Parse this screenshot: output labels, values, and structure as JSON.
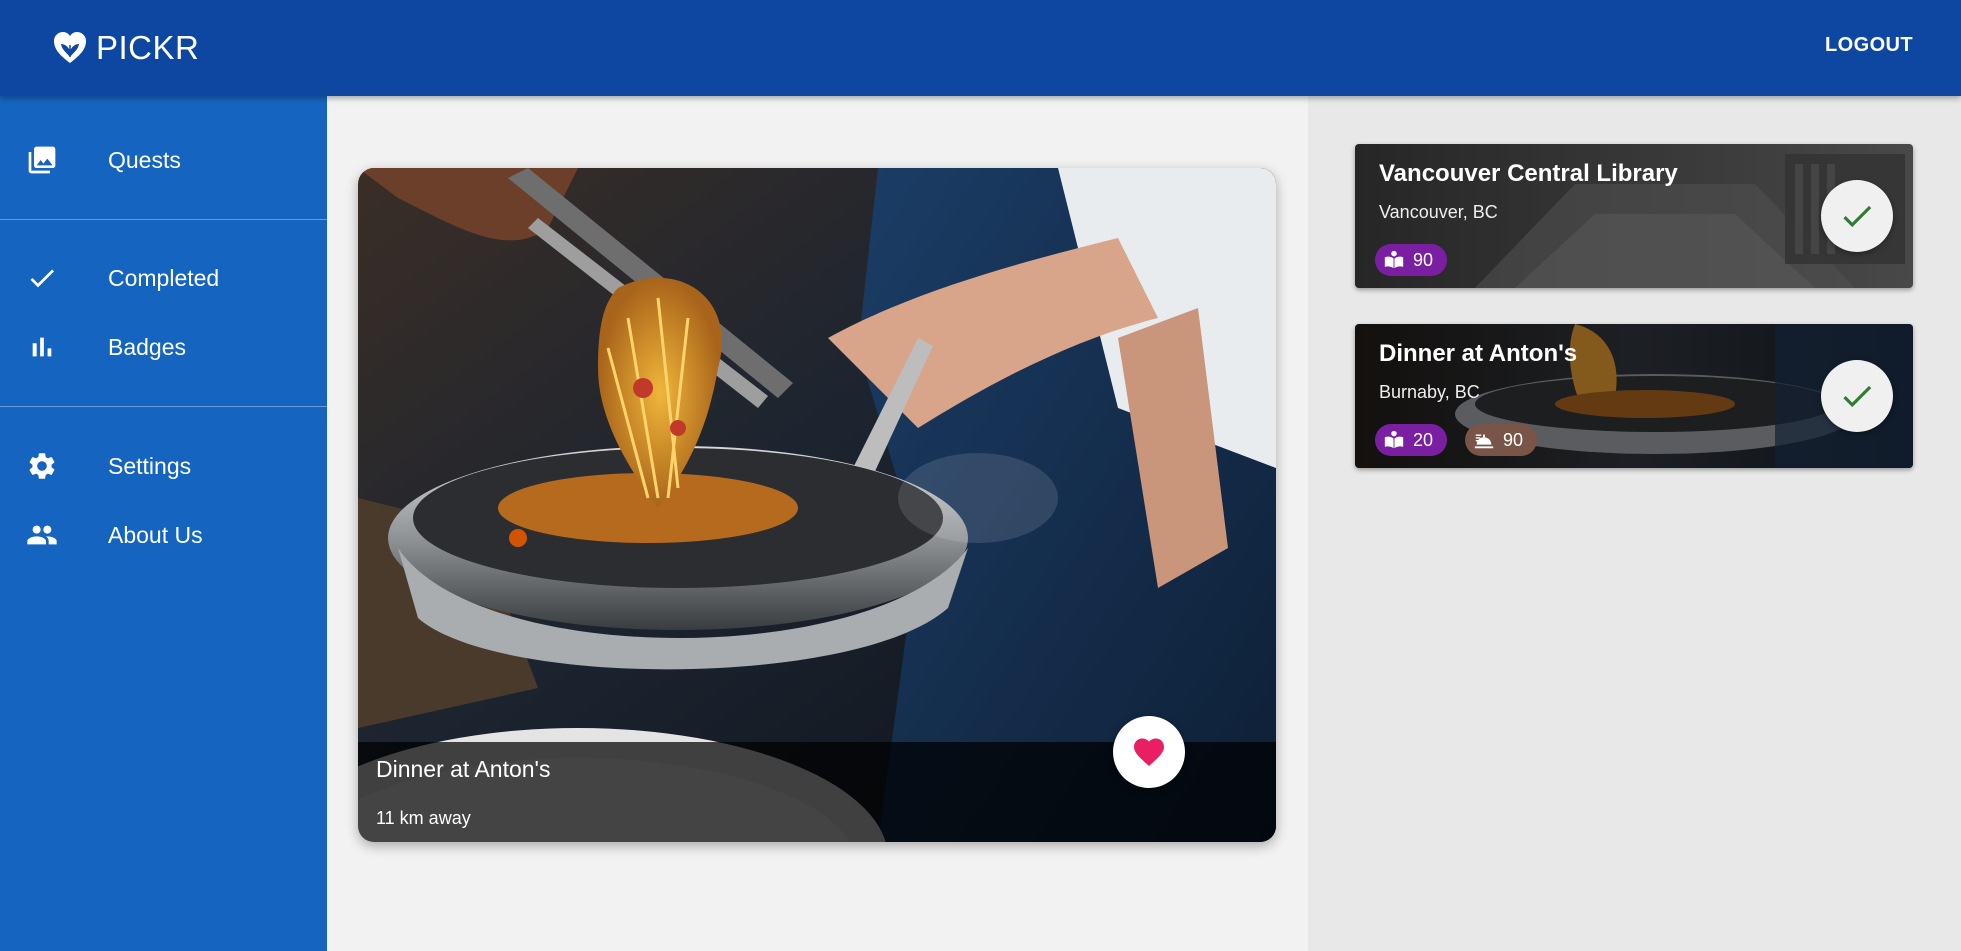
{
  "appbar": {
    "brand": "PICKR",
    "brand_icon": "heart-leaf-icon",
    "logout_label": "LOGOUT",
    "color": "#0d47a1"
  },
  "sidebar": {
    "color": "#1565c0",
    "items": [
      {
        "label": "Quests",
        "icon": "photo-library-icon"
      },
      {
        "label": "Completed",
        "icon": "check-icon"
      },
      {
        "label": "Badges",
        "icon": "bar-chart-icon"
      },
      {
        "label": "Settings",
        "icon": "gear-icon"
      },
      {
        "label": "About Us",
        "icon": "people-icon"
      }
    ]
  },
  "main": {
    "quest": {
      "title": "Dinner at Anton's",
      "distance": "11 km away",
      "favorite_icon": "heart-icon",
      "favorite_color": "#e91e63"
    }
  },
  "completed": [
    {
      "title": "Vancouver Central Library",
      "location": "Vancouver, BC",
      "chips": [
        {
          "icon": "book-reader-icon",
          "value": "90",
          "color": "#7b1fa2"
        }
      ]
    },
    {
      "title": "Dinner at Anton's",
      "location": "Burnaby, BC",
      "chips": [
        {
          "icon": "book-reader-icon",
          "value": "20",
          "color": "#7b1fa2"
        },
        {
          "icon": "food-icon",
          "value": "90",
          "color": "#795548"
        }
      ]
    }
  ],
  "check_color": "#2e7d32"
}
